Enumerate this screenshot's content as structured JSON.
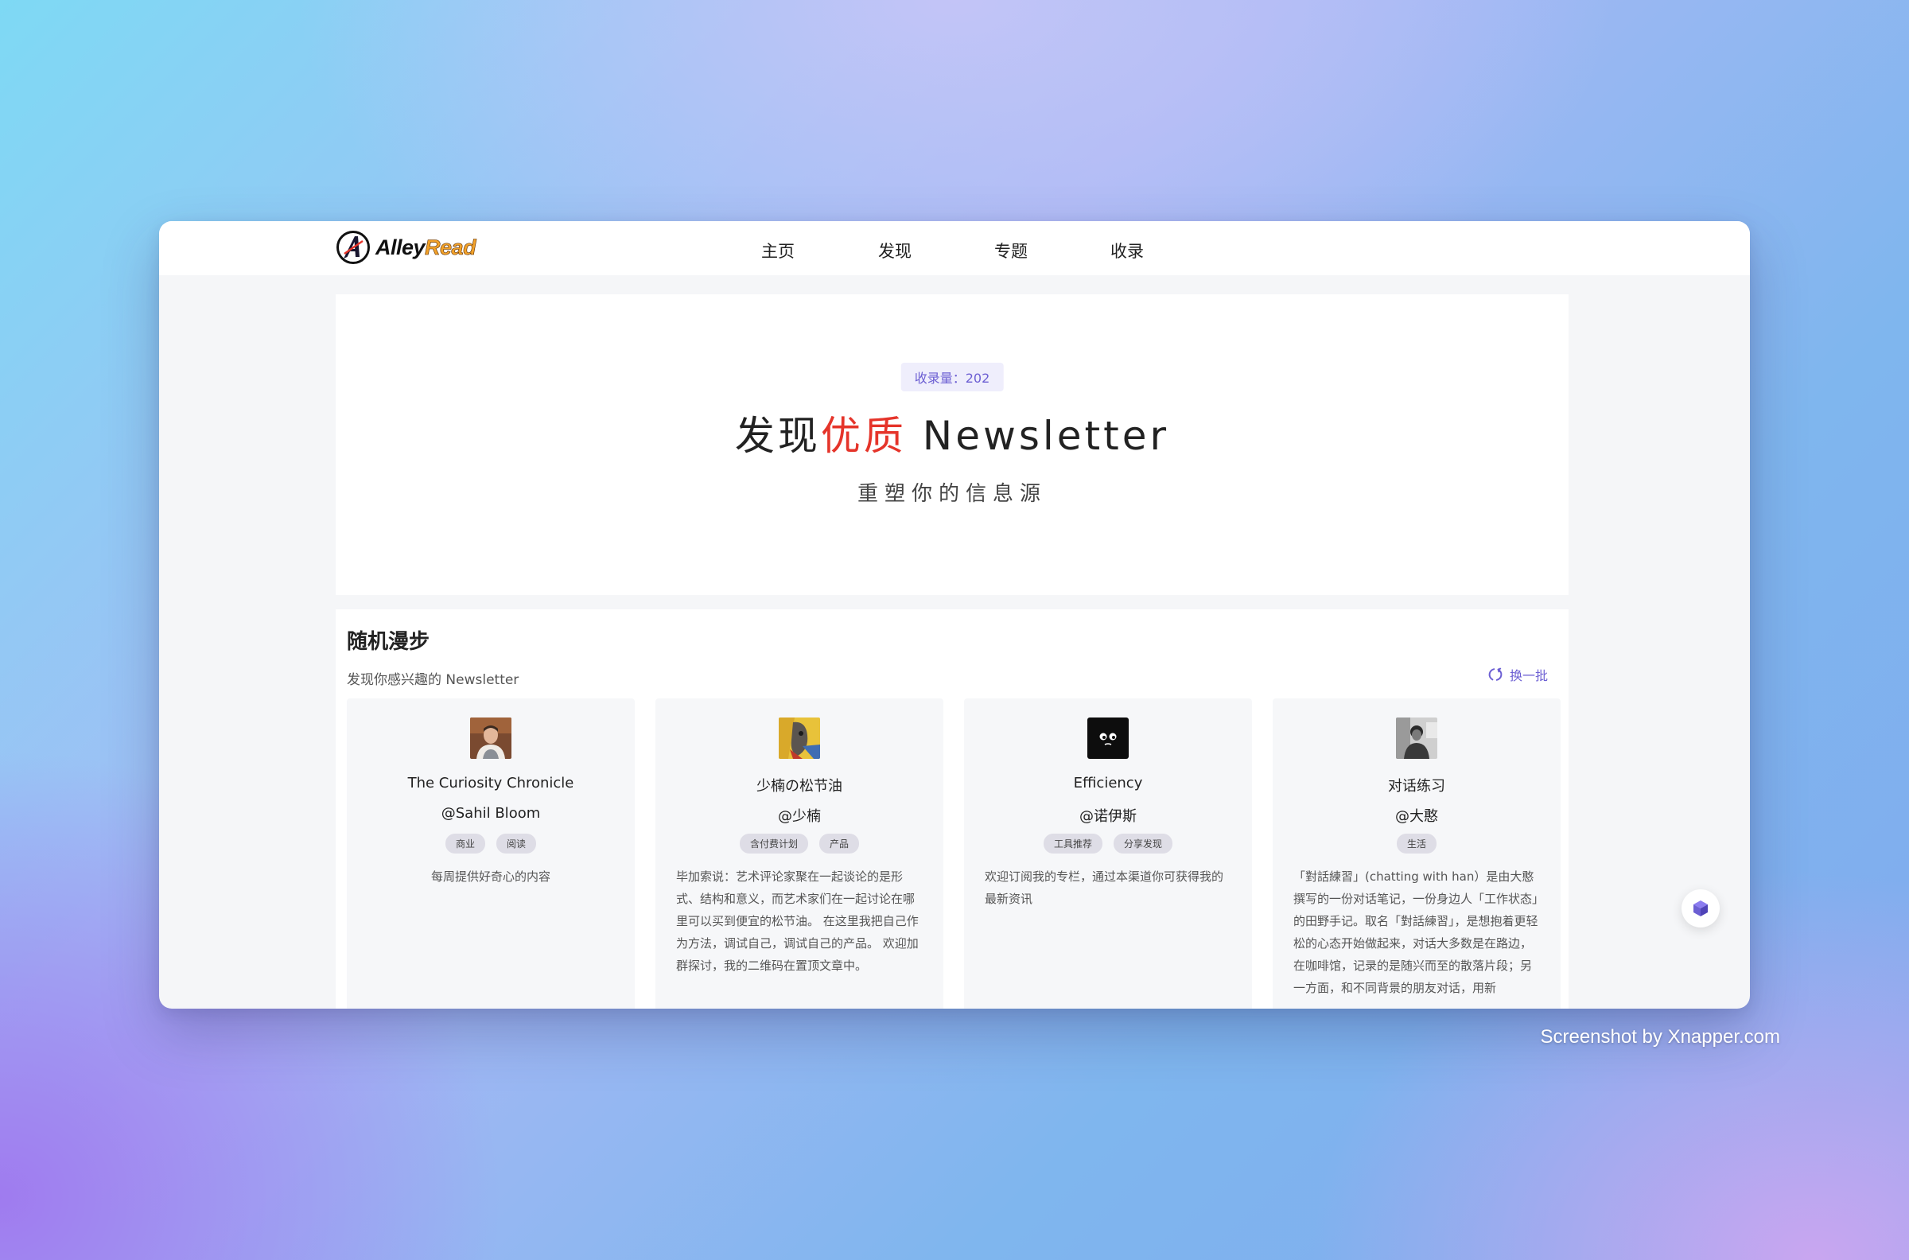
{
  "brand": {
    "part1": "Alley",
    "part2": "Read"
  },
  "nav": [
    {
      "label": "主页"
    },
    {
      "label": "发现"
    },
    {
      "label": "专题"
    },
    {
      "label": "收录"
    }
  ],
  "hero": {
    "count_label": "收录量：202",
    "title_prefix": "发现",
    "title_highlight": "优质",
    "title_suffix": " Newsletter",
    "subtitle": "重塑你的信息源"
  },
  "section": {
    "title": "随机漫步",
    "subtitle": "发现你感兴趣的 Newsletter",
    "refresh_label": "换一批",
    "cards": [
      {
        "name": "The Curiosity Chronicle",
        "author": "@Sahil Bloom",
        "tags": [
          "商业",
          "阅读"
        ],
        "description": "每周提供好奇心的内容"
      },
      {
        "name": "少楠の松节油",
        "author": "@少楠",
        "tags": [
          "含付费计划",
          "产品"
        ],
        "description": "毕加索说：艺术评论家聚在一起谈论的是形式、结构和意义，而艺术家们在一起讨论在哪里可以买到便宜的松节油。 在这里我把自己作为方法，调试自己，调试自己的产品。 欢迎加群探讨，我的二维码在置顶文章中。"
      },
      {
        "name": "Efficiency",
        "author": "@诺伊斯",
        "tags": [
          "工具推荐",
          "分享发现"
        ],
        "description": "欢迎订阅我的专栏，通过本渠道你可获得我的最新资讯"
      },
      {
        "name": "对话练习",
        "author": "@大憨",
        "tags": [
          "生活"
        ],
        "description": "「對話練習」(chatting with han）是由大憨撰写的一份对话笔记，一份身边人「工作状态」的田野手记。取名「對話練習」，是想抱着更轻松的心态开始做起来，对话大多数是在路边，在咖啡馆，记录的是随兴而至的散落片段；另一方面，和不同背景的朋友对话，用新"
      }
    ]
  },
  "watermark": "Screenshot by Xnapper.com",
  "colors": {
    "accent": "#6c5fd3",
    "highlight": "#e5342a",
    "logo_orange": "#f2a22a"
  },
  "icons": {
    "logo": "alleyread-logo-icon",
    "refresh": "refresh-icon",
    "float": "cube-icon"
  }
}
